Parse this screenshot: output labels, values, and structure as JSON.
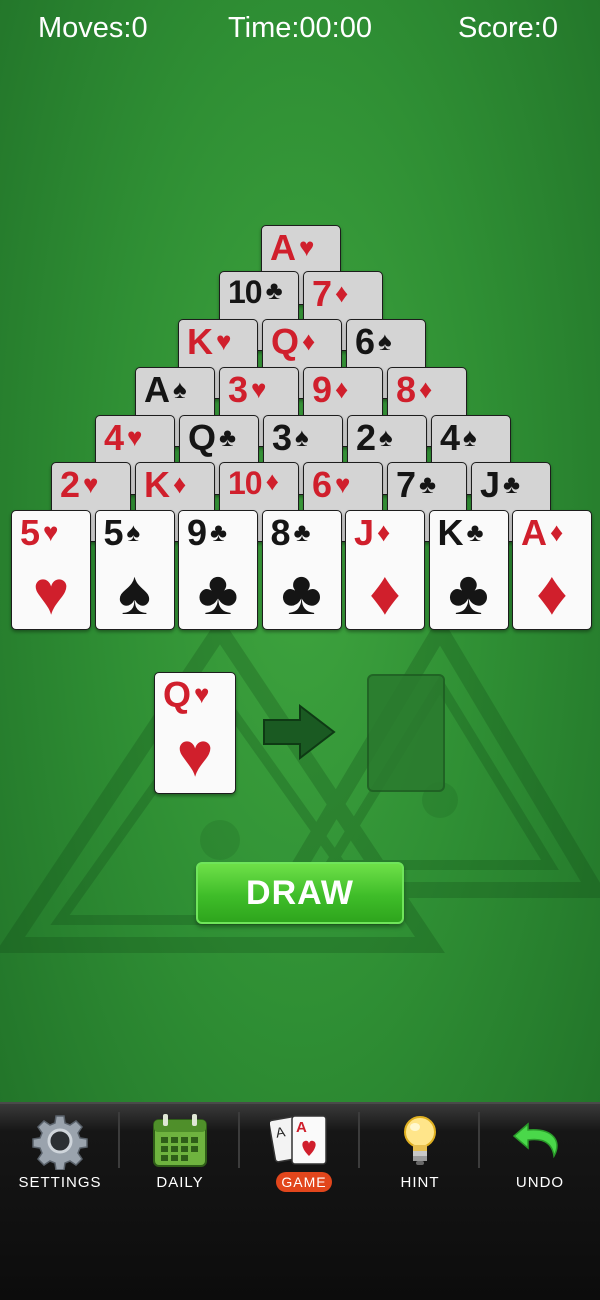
{
  "hud": {
    "moves": "Moves:0",
    "time": "Time:00:00",
    "score": "Score:0"
  },
  "pyramid": [
    [
      {
        "rank": "A",
        "suit": "♥",
        "color": "red"
      }
    ],
    [
      {
        "rank": "10",
        "suit": "♣",
        "color": "black"
      },
      {
        "rank": "7",
        "suit": "♦",
        "color": "red"
      }
    ],
    [
      {
        "rank": "K",
        "suit": "♥",
        "color": "red"
      },
      {
        "rank": "Q",
        "suit": "♦",
        "color": "red"
      },
      {
        "rank": "6",
        "suit": "♠",
        "color": "black"
      }
    ],
    [
      {
        "rank": "A",
        "suit": "♠",
        "color": "black"
      },
      {
        "rank": "3",
        "suit": "♥",
        "color": "red"
      },
      {
        "rank": "9",
        "suit": "♦",
        "color": "red"
      },
      {
        "rank": "8",
        "suit": "♦",
        "color": "red"
      }
    ],
    [
      {
        "rank": "4",
        "suit": "♥",
        "color": "red"
      },
      {
        "rank": "Q",
        "suit": "♣",
        "color": "black"
      },
      {
        "rank": "3",
        "suit": "♠",
        "color": "black"
      },
      {
        "rank": "2",
        "suit": "♠",
        "color": "black"
      },
      {
        "rank": "4",
        "suit": "♠",
        "color": "black"
      }
    ],
    [
      {
        "rank": "2",
        "suit": "♥",
        "color": "red"
      },
      {
        "rank": "K",
        "suit": "♦",
        "color": "red"
      },
      {
        "rank": "10",
        "suit": "♦",
        "color": "red"
      },
      {
        "rank": "6",
        "suit": "♥",
        "color": "red"
      },
      {
        "rank": "7",
        "suit": "♣",
        "color": "black"
      },
      {
        "rank": "J",
        "suit": "♣",
        "color": "black"
      }
    ],
    [
      {
        "rank": "5",
        "suit": "♥",
        "color": "red"
      },
      {
        "rank": "5",
        "suit": "♠",
        "color": "black"
      },
      {
        "rank": "9",
        "suit": "♣",
        "color": "black"
      },
      {
        "rank": "8",
        "suit": "♣",
        "color": "black"
      },
      {
        "rank": "J",
        "suit": "♦",
        "color": "red"
      },
      {
        "rank": "K",
        "suit": "♣",
        "color": "black"
      },
      {
        "rank": "A",
        "suit": "♦",
        "color": "red"
      }
    ]
  ],
  "stock_card": {
    "rank": "Q",
    "suit": "♥",
    "color": "red"
  },
  "draw_label": "DRAW",
  "nav": {
    "settings": "SETTINGS",
    "daily": "DAILY",
    "game": "GAME",
    "hint": "HINT",
    "undo": "UNDO"
  },
  "colors": {
    "felt": "#2f8f34",
    "red_suit": "#d01f2c",
    "black_suit": "#151515",
    "draw_button": "#3fbd29",
    "game_badge": "#e2461c"
  }
}
